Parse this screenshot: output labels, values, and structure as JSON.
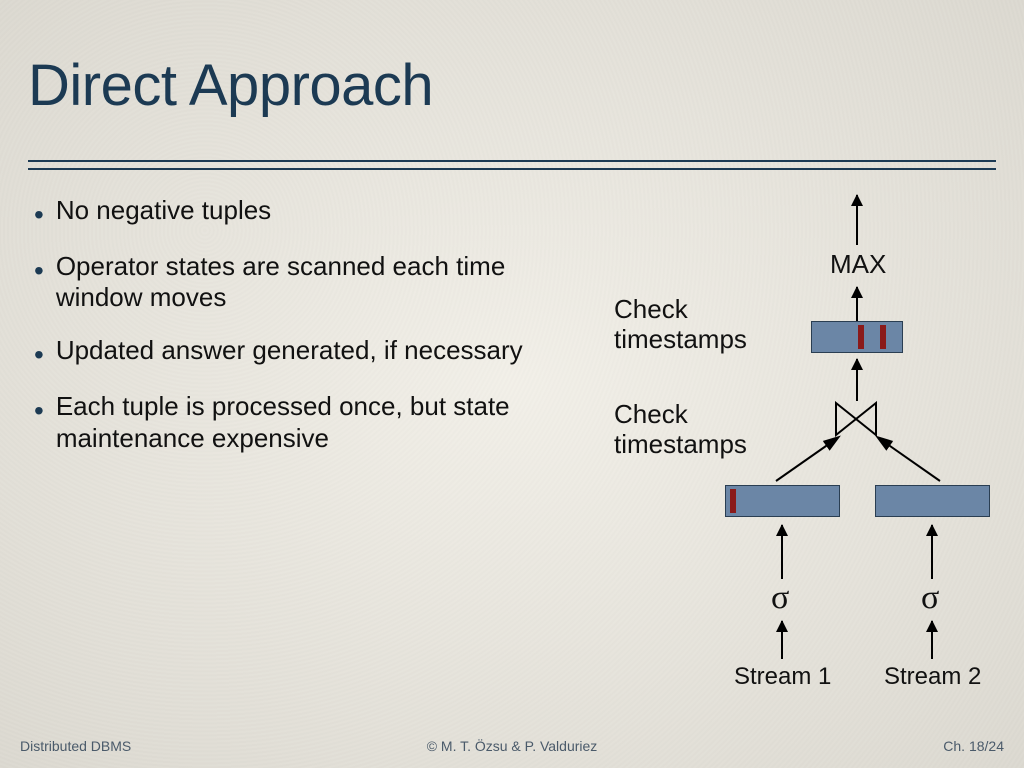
{
  "title": "Direct Approach",
  "bullets": [
    "No negative tuples",
    "Operator states are scanned each time window moves",
    "Updated answer generated, if necessary",
    "Each tuple is processed once, but state maintenance expensive"
  ],
  "diagram": {
    "max": "MAX",
    "check1": "Check timestamps",
    "check2": "Check timestamps",
    "sigma1": "σ",
    "sigma2": "σ",
    "stream1": "Stream 1",
    "stream2": "Stream 2"
  },
  "footer": {
    "left": "Distributed DBMS",
    "center": "© M. T. Özsu & P. Valduriez",
    "right": "Ch. 18/24"
  }
}
